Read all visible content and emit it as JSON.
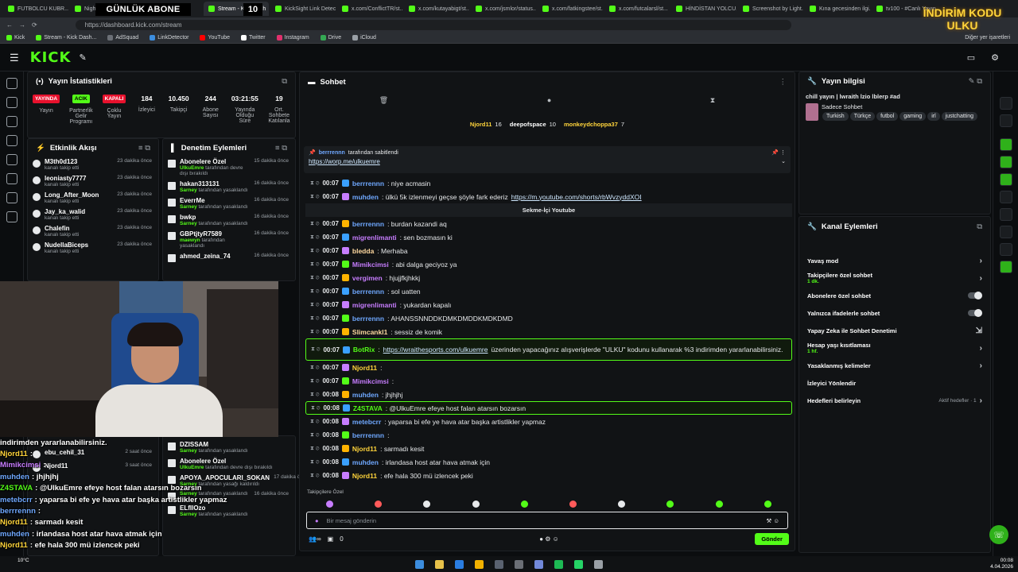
{
  "browser": {
    "tabs": [
      {
        "label": "FUTBOLCU KUBR..."
      },
      {
        "label": "Nightbot"
      },
      {
        "label": "OnlyDrama"
      },
      {
        "label": "Stream - Kick Dash",
        "active": true
      },
      {
        "label": "KickSight Link Detector"
      },
      {
        "label": "x.com/ConflictTR/st..."
      },
      {
        "label": "x.com/kutayabigt/st..."
      },
      {
        "label": "x.com/jsmlor/status..."
      },
      {
        "label": "x.com/fatkingstee/st..."
      },
      {
        "label": "x.com/futcalarsl/st..."
      },
      {
        "label": "HİNDİSTAN YOLCU..."
      },
      {
        "label": "Screenshot by Light..."
      },
      {
        "label": "Kına gecesinden ilgi..."
      },
      {
        "label": "tv100 - #Canlı Yayın"
      }
    ],
    "url": "https://dashboard.kick.com/stream",
    "bookmarks": [
      "Kick",
      "Stream - Kick Dash...",
      "AdSquad",
      "LinkDetector",
      "YouTube",
      "Twitter",
      "Instagram",
      "Drive",
      "iCloud"
    ],
    "bookmarks_right": "Diğer yer işaretleri",
    "profile_label": "Sohbet et"
  },
  "overlay": {
    "title": "GÜNLÜK ABONE",
    "count": "10",
    "left_count": "0",
    "promo": "İNDİRİM KODU ULKU"
  },
  "stats": {
    "title": "Yayın İstatistikleri",
    "items": [
      {
        "badge": "YAYINDA",
        "badge_color": "#e8112d",
        "label": "Yayın"
      },
      {
        "badge": "ACIK",
        "badge_color": "#53fc18",
        "label": "Partnerlik Gelir Programı"
      },
      {
        "badge": "KAPALI",
        "badge_color": "#e8112d",
        "label": "Çoklu Yayın"
      },
      {
        "value": "184",
        "label": "İzleyici"
      },
      {
        "value": "10.450",
        "label": "Takipçi"
      },
      {
        "value": "244",
        "label": "Abone Sayısı"
      },
      {
        "value": "03:21:55",
        "label": "Yayında Olduğu Süre"
      },
      {
        "value": "19",
        "label": "Ort. Sohbete Katılanla"
      }
    ]
  },
  "events": {
    "title": "Etkinlik Akışı",
    "items": [
      {
        "name": "M3th0d123",
        "sub": "kanalı takip etti",
        "time": "23 dakika önce"
      },
      {
        "name": "leoniasty7777",
        "sub": "kanalı takip etti",
        "time": "23 dakika önce"
      },
      {
        "name": "Long_After_Moon",
        "sub": "kanalı takip etti",
        "time": "23 dakika önce"
      },
      {
        "name": "Jay_ka_walid",
        "sub": "kanalı takip etti",
        "time": "23 dakika önce"
      },
      {
        "name": "Chalefin",
        "sub": "kanalı takip etti",
        "time": "23 dakika önce"
      },
      {
        "name": "NudellaBiceps",
        "sub": "kanalı takip etti",
        "time": "23 dakika önce"
      }
    ],
    "lower": [
      {
        "name": "ebu_cehil_31",
        "sub": "",
        "time": "2 saat önce"
      },
      {
        "name": "Njord11",
        "sub": "",
        "time": "3 saat önce"
      }
    ]
  },
  "moderation": {
    "title": "Denetim Eylemleri",
    "items": [
      {
        "name": "Abonelere Özel",
        "actor": "UlkuEmre",
        "sub": "tarafından devre dışı bırakıldı",
        "time": "15 dakika önce"
      },
      {
        "name": "hakan313131",
        "actor": "Sarney",
        "sub": "tarafından yasaklandı",
        "time": "16 dakika önce"
      },
      {
        "name": "EverrMe",
        "actor": "Sarney",
        "sub": "tarafından yasaklandı",
        "time": "16 dakika önce"
      },
      {
        "name": "bwkp",
        "actor": "Sarney",
        "sub": "tarafından yasaklandı",
        "time": "16 dakika önce"
      },
      {
        "name": "GBPtjtyR7589",
        "actor": "maewyn",
        "sub": "tarafından yasaklandı",
        "time": "16 dakika önce"
      },
      {
        "name": "ahmed_zeina_74",
        "actor": "",
        "sub": "",
        "time": "16 dakika önce"
      }
    ],
    "lower": [
      {
        "name": "DZISSAM",
        "actor": "Sarney",
        "sub": "tarafından yasaklandı",
        "time": ""
      },
      {
        "name": "Abonelere Özel",
        "actor": "UlkuEmre",
        "sub": "tarafından devre dışı bırakıldı",
        "time": ""
      },
      {
        "name": "APOYA_APOCULARI_SOKAN",
        "actor": "Sarney",
        "sub": "tarafından yasağı kaldırıldı",
        "time": "17 dakika önce"
      },
      {
        "name": "",
        "actor": "Sarney",
        "sub": "tarafından yasaklandı",
        "time": "16 dakika önce"
      },
      {
        "name": "ELfIlOzo",
        "actor": "Sarney",
        "sub": "tarafından yasaklandı",
        "time": ""
      }
    ]
  },
  "overlay_chat": [
    {
      "user": "",
      "text": "indirimden yararlanabilirsiniz.",
      "color": "#ffffff"
    },
    {
      "user": "Njord11",
      "text": ":",
      "color": "#ffd43b"
    },
    {
      "user": "Mimikcimsi",
      "text": ":",
      "color": "#c77dff"
    },
    {
      "user": "muhden",
      "text": ": jhjhjhj",
      "color": "#6fa8ff"
    },
    {
      "user": "Z4STAVA",
      "text": ": @UlkuEmre efeye host falan atarsın bozarsın",
      "color": "#53fc18"
    },
    {
      "user": "metebcrr",
      "text": ": yaparsa bi efe ye hava atar başka artistlikler yapmaz",
      "color": "#6fa8ff"
    },
    {
      "user": "berrrennn",
      "text": ":",
      "color": "#6fa8ff"
    },
    {
      "user": "Njord11",
      "text": ": sarmadı kesit",
      "color": "#ffd43b"
    },
    {
      "user": "muhden",
      "text": ": irlandasa host atar hava atmak için",
      "color": "#6fa8ff"
    },
    {
      "user": "Njord11",
      "text": ": efe hala 300 mü izlencek peki",
      "color": "#ffd43b"
    }
  ],
  "chat": {
    "title": "Sohbet",
    "gifters": [
      {
        "name": "Njord11",
        "count": "16",
        "color": "#ffd43b"
      },
      {
        "name": "deepofspace",
        "count": "10",
        "color": "#ffffff"
      },
      {
        "name": "monkeydchoppa37",
        "count": "7",
        "color": "#ffd43b"
      }
    ],
    "pinned": {
      "by": "berrrennn",
      "by_suffix": "tarafından sabitlendi",
      "link": "https://worp.me/ulkuemre"
    },
    "messages": [
      {
        "time": "00:07",
        "user": "berrrennn",
        "color": "#6fa8ff",
        "text": ": niye acmasin"
      },
      {
        "time": "00:07",
        "user": "muhden",
        "color": "#6fa8ff",
        "text": ": ülkü 5k izlenmeyi geçse şöyle fark ederiz",
        "link": "https://m.youtube.com/shorts/rbWvzyddXOI"
      },
      {
        "system": "Sekme-İçi Youtube"
      },
      {
        "time": "00:07",
        "user": "berrrennn",
        "color": "#6fa8ff",
        "text": ": burdan kazandi aq"
      },
      {
        "time": "00:07",
        "user": "migrenlimanti",
        "color": "#c77dff",
        "text": ": sen bozmasın ki"
      },
      {
        "time": "00:07",
        "user": "bledda",
        "color": "#ffd9a0",
        "text": ": Merhaba"
      },
      {
        "time": "00:07",
        "user": "Mimikcimsi",
        "color": "#c77dff",
        "text": ": abi dalga geciyoz ya"
      },
      {
        "time": "00:07",
        "user": "vergimen",
        "color": "#c77dff",
        "text": ": hjujjfkjhkkj"
      },
      {
        "time": "00:07",
        "user": "berrrennn",
        "color": "#6fa8ff",
        "text": ": sol uatten"
      },
      {
        "time": "00:07",
        "user": "migrenlimanti",
        "color": "#c77dff",
        "text": ": yukardan kapalı"
      },
      {
        "time": "00:07",
        "user": "berrrennn",
        "color": "#6fa8ff",
        "text": ": AHANSSNNDDKDMKDMDDKMDKDMD"
      },
      {
        "time": "00:07",
        "user": "Slimcankl1",
        "color": "#ffd9a0",
        "text": ": sessiz de komik"
      },
      {
        "time": "00:07",
        "user": "BotRix",
        "color": "#53fc18",
        "text": ":",
        "link": "https://wraithesports.com/ulkuemre",
        "text2": "üzerinden yapacağınız alışverişlerde \"ULKU\" kodunu kullanarak %3 indirimden yararlanabilirsiniz.",
        "highlight": true
      },
      {
        "time": "00:07",
        "user": "Njord11",
        "color": "#ffd43b",
        "text": ":"
      },
      {
        "time": "00:07",
        "user": "Mimikcimsi",
        "color": "#c77dff",
        "text": ":"
      },
      {
        "time": "00:08",
        "user": "muhden",
        "color": "#6fa8ff",
        "text": ": jhjhjhj"
      },
      {
        "time": "00:08",
        "user": "Z4STAVA",
        "color": "#53fc18",
        "text": ": @UlkuEmre efeye host falan atarsın bozarsın",
        "highlight": true
      },
      {
        "time": "00:08",
        "user": "metebcrr",
        "color": "#6fa8ff",
        "text": ": yaparsa bi efe ye hava atar başka artistlikler yapmaz"
      },
      {
        "time": "00:08",
        "user": "berrrennn",
        "color": "#6fa8ff",
        "text": ":"
      },
      {
        "time": "00:08",
        "user": "Njord11",
        "color": "#ffd43b",
        "text": ": sarmadı kesit"
      },
      {
        "time": "00:08",
        "user": "muhden",
        "color": "#6fa8ff",
        "text": ": irlandasa host atar hava atmak için"
      },
      {
        "time": "00:08",
        "user": "Njord11",
        "color": "#ffd43b",
        "text": ": efe hala 300 mü izlencek peki"
      }
    ],
    "emote_label": "Takipçilere Özel",
    "input_placeholder": "Bir mesaj gönderin",
    "footer_count": "0",
    "send_label": "Gönder"
  },
  "stream_info": {
    "title": "Yayın bilgisi",
    "stream_title": "chill yayın | lwraith lzio lblerp #ad",
    "category": "Sadece Sohbet",
    "tags": [
      "Turkish",
      "Türkçe",
      "futbol",
      "gaming",
      "irl",
      "justchatting"
    ]
  },
  "channel_actions": {
    "title": "Kanal Eylemleri",
    "items": [
      {
        "label": "Yavaş mod",
        "kind": "arrow"
      },
      {
        "label": "Takipçilere özel sohbet",
        "sub": "1 dk.",
        "kind": "arrow"
      },
      {
        "label": "Abonelere özel sohbet",
        "kind": "toggle"
      },
      {
        "label": "Yalnızca ifadelerle sohbet",
        "kind": "toggle"
      },
      {
        "label": "Yapay Zeka ile Sohbet Denetimi",
        "kind": "link"
      },
      {
        "label": "Hesap yaşı kısıtlaması",
        "sub": "1 hf.",
        "kind": "arrow"
      },
      {
        "label": "Yasaklanmış kelimeler",
        "kind": "arrow"
      },
      {
        "label": "İzleyici Yönlendir",
        "kind": "none"
      },
      {
        "label": "Hedefleri belirleyin",
        "sub_right": "Aktif hedefler · 1",
        "kind": "arrow"
      }
    ]
  },
  "taskbar": {
    "time": "00:08",
    "date": "4.04.2026",
    "weather": "10°C"
  }
}
